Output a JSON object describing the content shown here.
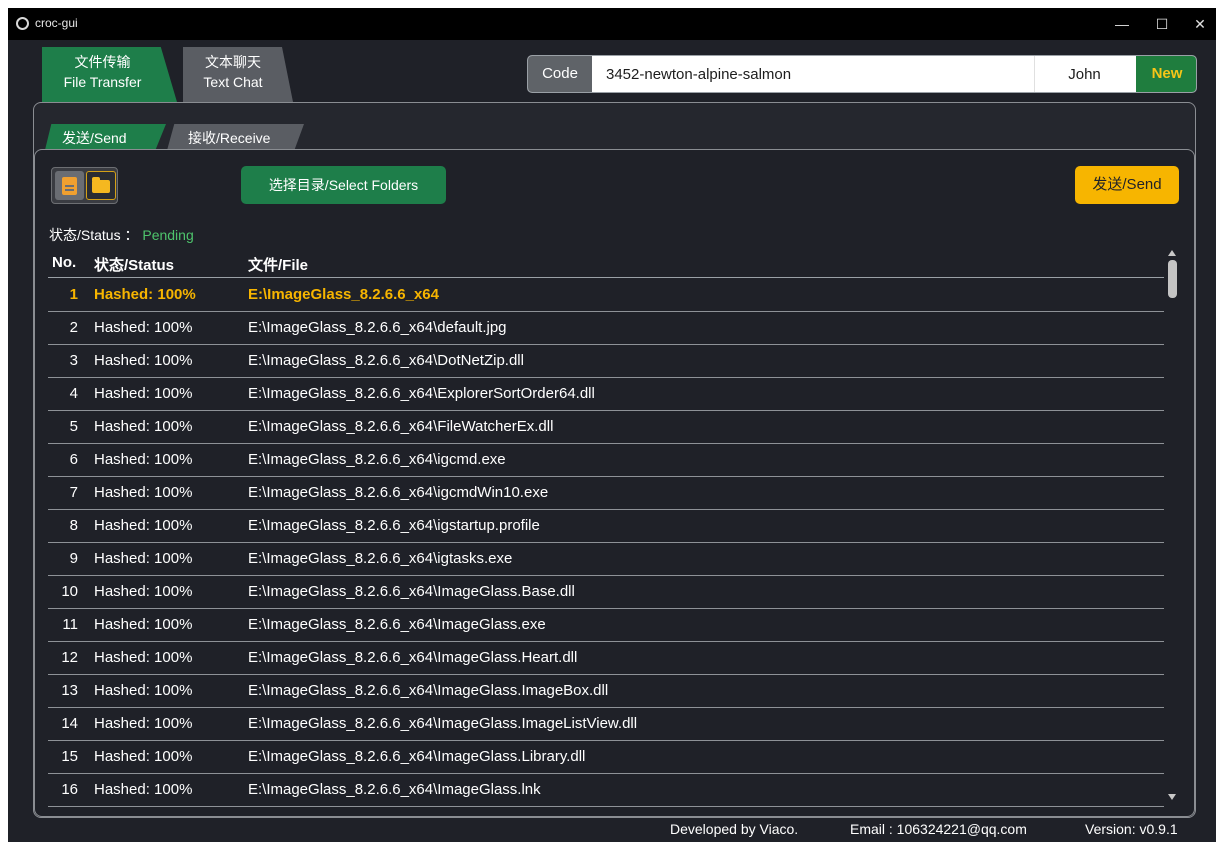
{
  "window": {
    "title": "croc-gui",
    "controls": {
      "minimize": "—",
      "maximize": "☐",
      "close": "✕"
    }
  },
  "top_tabs": [
    {
      "label_cn": "文件传输",
      "label_en": "File Transfer",
      "active": true
    },
    {
      "label_cn": "文本聊天",
      "label_en": "Text Chat",
      "active": false
    }
  ],
  "code_bar": {
    "label": "Code",
    "code_value": "3452-newton-alpine-salmon",
    "name_value": "John",
    "new_label": "New"
  },
  "sub_tabs": [
    {
      "label": "发送/Send",
      "active": true
    },
    {
      "label": "接收/Receive",
      "active": false
    }
  ],
  "toolbar": {
    "file_icon": "file-icon",
    "folder_icon": "folder-icon",
    "select_label": "选择目录/Select Folders",
    "send_label": "发送/Send"
  },
  "status": {
    "label": "状态/Status ：",
    "value": "Pending"
  },
  "table": {
    "columns": [
      "No.",
      "状态/Status",
      "文件/File"
    ],
    "rows": [
      {
        "no": "1",
        "status": "Hashed: 100%",
        "file": "E:\\ImageGlass_8.2.6.6_x64"
      },
      {
        "no": "2",
        "status": "Hashed: 100%",
        "file": "E:\\ImageGlass_8.2.6.6_x64\\default.jpg"
      },
      {
        "no": "3",
        "status": "Hashed: 100%",
        "file": "E:\\ImageGlass_8.2.6.6_x64\\DotNetZip.dll"
      },
      {
        "no": "4",
        "status": "Hashed: 100%",
        "file": "E:\\ImageGlass_8.2.6.6_x64\\ExplorerSortOrder64.dll"
      },
      {
        "no": "5",
        "status": "Hashed: 100%",
        "file": "E:\\ImageGlass_8.2.6.6_x64\\FileWatcherEx.dll"
      },
      {
        "no": "6",
        "status": "Hashed: 100%",
        "file": "E:\\ImageGlass_8.2.6.6_x64\\igcmd.exe"
      },
      {
        "no": "7",
        "status": "Hashed: 100%",
        "file": "E:\\ImageGlass_8.2.6.6_x64\\igcmdWin10.exe"
      },
      {
        "no": "8",
        "status": "Hashed: 100%",
        "file": "E:\\ImageGlass_8.2.6.6_x64\\igstartup.profile"
      },
      {
        "no": "9",
        "status": "Hashed: 100%",
        "file": "E:\\ImageGlass_8.2.6.6_x64\\igtasks.exe"
      },
      {
        "no": "10",
        "status": "Hashed: 100%",
        "file": "E:\\ImageGlass_8.2.6.6_x64\\ImageGlass.Base.dll"
      },
      {
        "no": "11",
        "status": "Hashed: 100%",
        "file": "E:\\ImageGlass_8.2.6.6_x64\\ImageGlass.exe"
      },
      {
        "no": "12",
        "status": "Hashed: 100%",
        "file": "E:\\ImageGlass_8.2.6.6_x64\\ImageGlass.Heart.dll"
      },
      {
        "no": "13",
        "status": "Hashed: 100%",
        "file": "E:\\ImageGlass_8.2.6.6_x64\\ImageGlass.ImageBox.dll"
      },
      {
        "no": "14",
        "status": "Hashed: 100%",
        "file": "E:\\ImageGlass_8.2.6.6_x64\\ImageGlass.ImageListView.dll"
      },
      {
        "no": "15",
        "status": "Hashed: 100%",
        "file": "E:\\ImageGlass_8.2.6.6_x64\\ImageGlass.Library.dll"
      },
      {
        "no": "16",
        "status": "Hashed: 100%",
        "file": "E:\\ImageGlass_8.2.6.6_x64\\ImageGlass.lnk"
      }
    ]
  },
  "footer": {
    "developer": "Developed by Viaco.",
    "email": "Email : 106324221@qq.com",
    "version": "Version: v0.9.1"
  },
  "colors": {
    "accent_green": "#1e7e4a",
    "accent_yellow": "#f7b500",
    "status_green": "#4ec46c",
    "background": "#1f2128"
  }
}
